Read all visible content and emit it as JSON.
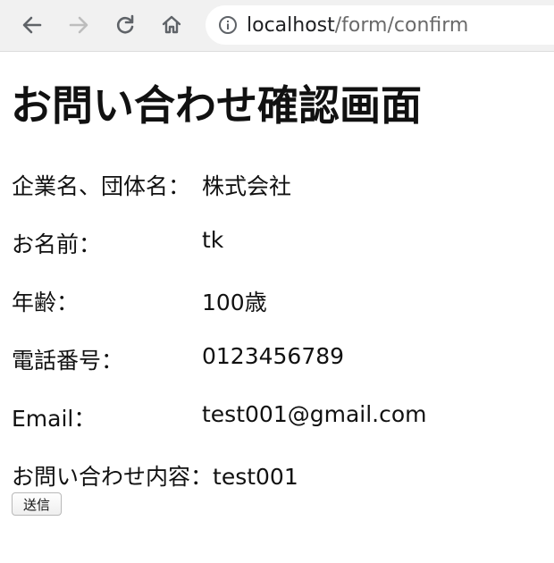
{
  "browser": {
    "url_host": "localhost",
    "url_path": "/form/confirm"
  },
  "page": {
    "title": "お問い合わせ確認画面"
  },
  "fields": [
    {
      "label": "企業名、団体名：",
      "value": "株式会社"
    },
    {
      "label": "お名前：",
      "value": "tk"
    },
    {
      "label": "年齢：",
      "value": "100歳"
    },
    {
      "label": "電話番号：",
      "value": "0123456789"
    },
    {
      "label": "Email：",
      "value": "test001@gmail.com"
    },
    {
      "label": "お問い合わせ内容：",
      "value": "test001"
    }
  ],
  "actions": {
    "submit_label": "送信"
  },
  "icons": {
    "back": "arrow-left-icon",
    "forward": "arrow-right-icon",
    "reload": "reload-icon",
    "home": "home-icon",
    "info": "info-icon"
  },
  "colors": {
    "toolbar_bg": "#f1f1f1",
    "icon_active": "#5f6368",
    "icon_disabled": "#bdbdbd",
    "url_path": "#6a6a6a"
  }
}
